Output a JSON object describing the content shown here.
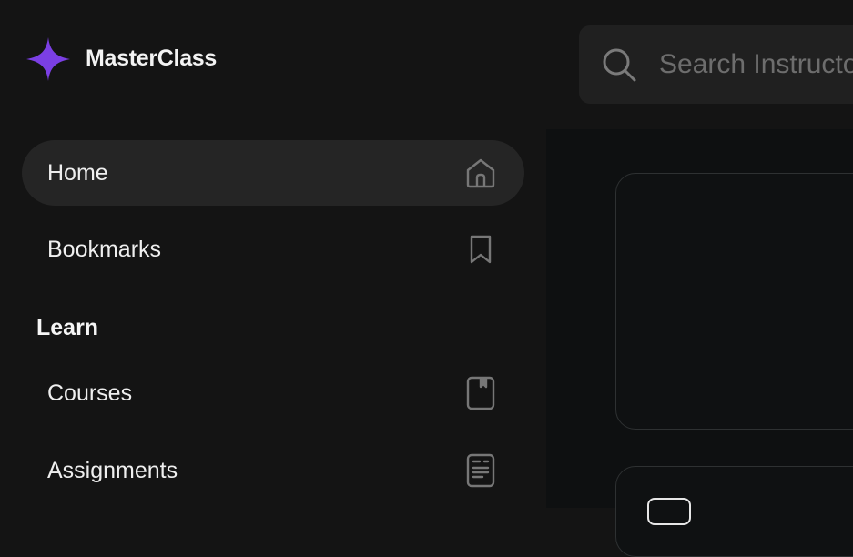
{
  "app": {
    "name": "MasterClass",
    "brand_color": "#7b3fe4"
  },
  "sidebar": {
    "items": [
      {
        "label": "Home",
        "icon": "home-icon",
        "active": true
      },
      {
        "label": "Bookmarks",
        "icon": "bookmark-icon",
        "active": false
      }
    ],
    "sections": [
      {
        "title": "Learn",
        "items": [
          {
            "label": "Courses",
            "icon": "book-icon"
          },
          {
            "label": "Assignments",
            "icon": "document-icon"
          }
        ]
      }
    ]
  },
  "search": {
    "placeholder": "Search Instructors",
    "icon": "search-icon"
  }
}
